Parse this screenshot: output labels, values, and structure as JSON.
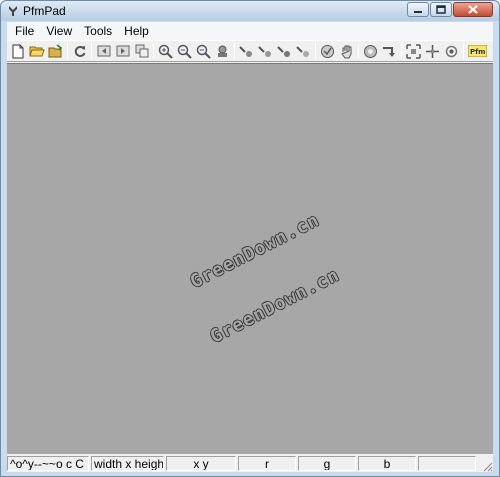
{
  "window": {
    "title": "PfmPad",
    "controls": [
      "minimize",
      "maximize",
      "close"
    ]
  },
  "menu": {
    "items": [
      {
        "label": "File"
      },
      {
        "label": "View"
      },
      {
        "label": "Tools"
      },
      {
        "label": "Help"
      }
    ]
  },
  "toolbar": {
    "groups": [
      [
        "new-icon",
        "open-icon",
        "save-icon"
      ],
      [
        "reload-icon"
      ],
      [
        "prev-image-icon",
        "next-image-icon",
        "copy-icon"
      ],
      [
        "zoom-in-icon",
        "zoom-out-icon",
        "zoom-fit-icon",
        "zoom-actual-icon"
      ],
      [
        "channel-a-icon",
        "channel-b-icon",
        "channel-c-icon",
        "channel-d-icon"
      ],
      [
        "tonemap-icon",
        "hand-icon"
      ],
      [
        "exposure-icon",
        "apply-icon"
      ],
      [
        "fit-window-icon",
        "crosshair-icon",
        "target-icon"
      ],
      [
        "pfm-icon"
      ]
    ],
    "pfm_label": "Pfm"
  },
  "canvas": {
    "background": "#a7a7a7",
    "watermarks": [
      "GreenDown.cn",
      "GreenDown.cn"
    ]
  },
  "status": {
    "mode": "^o^y--~~o c C",
    "size": "width x height",
    "coords": "x y",
    "r": "r",
    "g": "g",
    "b": "b",
    "extra": ""
  }
}
